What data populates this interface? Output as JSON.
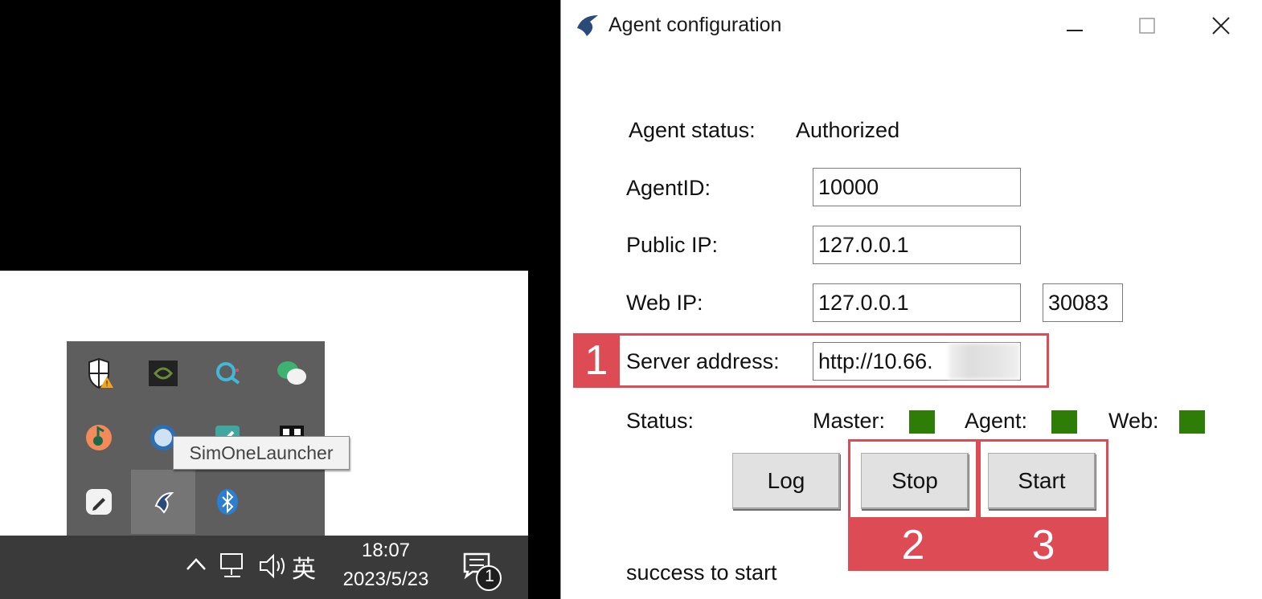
{
  "tray": {
    "tooltip": "SimOneLauncher",
    "time": "18:07",
    "date": "2023/5/23",
    "lang": "英",
    "notification_count": "1",
    "icons": [
      "defender-warning-icon",
      "nvidia-icon",
      "search-app-icon",
      "wechat-icon",
      "orange-app-icon",
      "blue-globe-icon",
      "green-app-icon",
      "qr-app-icon",
      "pen-app-icon",
      "simone-launcher-icon",
      "bluetooth-icon"
    ]
  },
  "window": {
    "title": "Agent configuration",
    "status_label": "Agent status:",
    "status_value": "Authorized",
    "agent_id_label": "AgentID:",
    "agent_id_value": "10000",
    "public_ip_label": "Public IP:",
    "public_ip_value": "127.0.0.1",
    "web_ip_label": "Web IP:",
    "web_ip_value": "127.0.0.1",
    "web_port_value": "30083",
    "server_label": "Server address:",
    "server_value": "http://10.66.",
    "status_row_label": "Status:",
    "master_label": "Master:",
    "agent_label": "Agent:",
    "web_label": "Web:",
    "log_button": "Log",
    "stop_button": "Stop",
    "start_button": "Start",
    "message": "success to start",
    "indicator_color": "#2e7d06"
  },
  "annotations": {
    "tag1": "1",
    "tag2": "2",
    "tag3": "3",
    "color": "#dd4b55"
  }
}
